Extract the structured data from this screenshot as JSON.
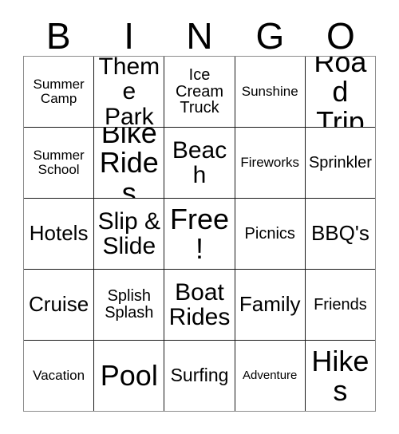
{
  "card": {
    "header_letters": [
      "B",
      "I",
      "N",
      "G",
      "O"
    ],
    "colors": {
      "background": "#ffffff",
      "text": "#000000",
      "outer_border": "#8c8c8c",
      "inner_border": "#1a1a1a"
    },
    "rows": [
      [
        {
          "label": "Summer Camp",
          "size": "s"
        },
        {
          "label": "Theme Park",
          "size": "xxl"
        },
        {
          "label": "Ice Cream Truck",
          "size": "m"
        },
        {
          "label": "Sunshine",
          "size": "s"
        },
        {
          "label": "Road Trip",
          "size": "xxxl"
        }
      ],
      [
        {
          "label": "Summer School",
          "size": "s"
        },
        {
          "label": "Bike Rides",
          "size": "xxxl"
        },
        {
          "label": "Beach",
          "size": "xxl"
        },
        {
          "label": "Fireworks",
          "size": "s"
        },
        {
          "label": "Sprinkler",
          "size": "m"
        }
      ],
      [
        {
          "label": "Hotels",
          "size": "xl"
        },
        {
          "label": "Slip & Slide",
          "size": "xxl"
        },
        {
          "label": "Free!",
          "size": "xxxl"
        },
        {
          "label": "Picnics",
          "size": "m"
        },
        {
          "label": "BBQ's",
          "size": "xl"
        }
      ],
      [
        {
          "label": "Cruise",
          "size": "xl"
        },
        {
          "label": "Splish Splash",
          "size": "m"
        },
        {
          "label": "Boat Rides",
          "size": "xxl"
        },
        {
          "label": "Family",
          "size": "xl"
        },
        {
          "label": "Friends",
          "size": "m"
        }
      ],
      [
        {
          "label": "Vacation",
          "size": "s"
        },
        {
          "label": "Pool",
          "size": "xxxl"
        },
        {
          "label": "Surfing",
          "size": "l"
        },
        {
          "label": "Adventure",
          "size": "xs"
        },
        {
          "label": "Hikes",
          "size": "xxxl"
        }
      ]
    ]
  }
}
